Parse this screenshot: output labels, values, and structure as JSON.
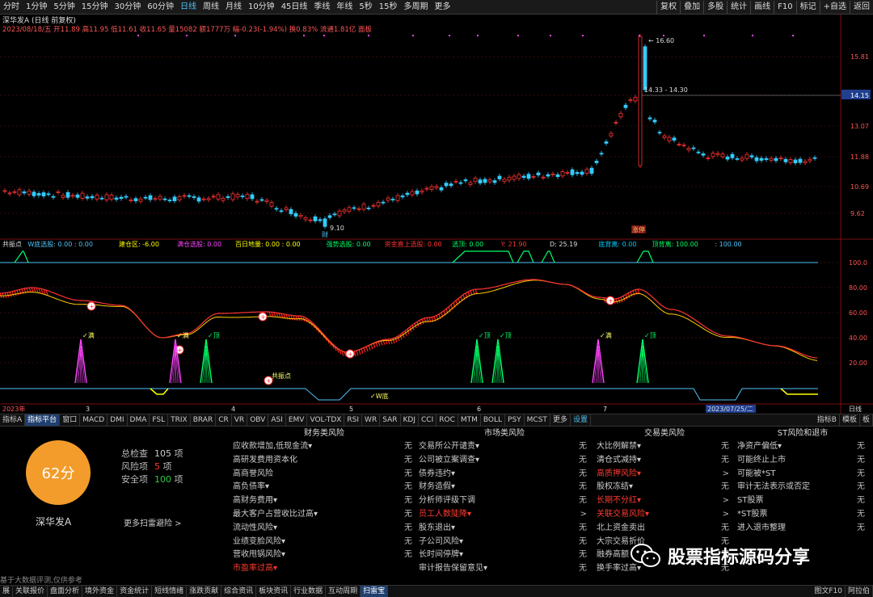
{
  "toolbar": {
    "timeframes": [
      "分时",
      "1分钟",
      "5分钟",
      "15分钟",
      "30分钟",
      "60分钟",
      "日线",
      "周线",
      "月线",
      "10分钟",
      "45日线",
      "季线",
      "年线",
      "5秒",
      "15秒",
      "多周期",
      "更多"
    ],
    "active": "日线",
    "buttons": [
      "复权",
      "叠加",
      "多股",
      "统计",
      "画线",
      "F10",
      "标记",
      "+自选",
      "返回"
    ]
  },
  "chart_header": {
    "line1": "深华发A (日线 前复权)",
    "line2": "2023/08/18/五 开11.89 高11.95 低11.61 收11.65 量15082 额1777万 幅-0.23(-1.94%) 换0.83% 流通1.81亿 面板"
  },
  "price_axis": [
    "15.81",
    "14.15",
    "13.07",
    "11.88",
    "10.69",
    "9.62"
  ],
  "current_price": "14.15",
  "price_annotations": {
    "high": "16.60",
    "range": "14.33 - 14.30",
    "low": "9.10"
  },
  "event_tags": [
    "财",
    "涨停"
  ],
  "indicator": {
    "header": [
      {
        "text": "共振点",
        "color": "#dddddd"
      },
      {
        "text": "W底选股: 0.00 : 0.00",
        "color": "#4fc3f7"
      },
      {
        "text": "建仓区: -6.00",
        "color": "#ffff00"
      },
      {
        "text": "满仓选股: 0.00",
        "color": "#ff44ff"
      },
      {
        "text": "百日地量: 0.00 : 0.00",
        "color": "#ffff00"
      },
      {
        "text": "强势选股: 0.00",
        "color": "#00ff66"
      },
      {
        "text": "资金直上选股: 0.00",
        "color": "#ff3333"
      },
      {
        "text": "选顶: 0.00",
        "color": "#00ff66"
      },
      {
        "text": "Y: 21.90",
        "color": "#ff3333"
      },
      {
        "text": "D: 25.19",
        "color": "#dddddd"
      },
      {
        "text": "底背离: 0.00",
        "color": "#00ccff"
      },
      {
        "text": "顶背离: 100.00",
        "color": "#00ff66"
      },
      {
        "text": ": 100.00",
        "color": "#4fc3f7"
      }
    ],
    "axis": [
      "100.0",
      "80.00",
      "60.00",
      "40.00",
      "20.00"
    ],
    "labels": {
      "man": "满",
      "ding": "顶",
      "gongzhen": "共振点",
      "wdi": "W底"
    }
  },
  "time_axis": [
    "2023年",
    "3",
    "4",
    "5",
    "6",
    "7",
    "2023/07/25/二",
    "日线"
  ],
  "tabs": [
    "指标A",
    "指标平台",
    "窗口",
    "MACD",
    "DMI",
    "DMA",
    "FSL",
    "TRIX",
    "BRAR",
    "CR",
    "VR",
    "OBV",
    "ASI",
    "EMV",
    "VOL-TDX",
    "RSI",
    "WR",
    "SAR",
    "KDJ",
    "CCI",
    "ROC",
    "MTM",
    "BOLL",
    "PSY",
    "MCST",
    "更多",
    "设置"
  ],
  "tabs_right": [
    "指标B",
    "模板",
    "板"
  ],
  "risk": {
    "score": "62分",
    "stock_name": "深华发A",
    "stats": [
      {
        "label": "总检查",
        "value": "105",
        "unit": "项",
        "color": "#cccccc"
      },
      {
        "label": "风险项",
        "value": "5",
        "unit": "项",
        "color": "#ff3b2f"
      },
      {
        "label": "安全项",
        "value": "100",
        "unit": "项",
        "color": "#2ecc40"
      }
    ],
    "more": "更多扫雷避险 >",
    "footnote": "基于大数据评测,仅供参考",
    "categories": [
      {
        "title": "财务类风险",
        "items": [
          {
            "label": "应收款增加,低现金流▾",
            "value": "无",
            "red": false
          },
          {
            "label": "高研发费用资本化",
            "value": "无",
            "red": false
          },
          {
            "label": "高商誉风险",
            "value": "无",
            "red": false
          },
          {
            "label": "高负债率▾",
            "value": "无",
            "red": false
          },
          {
            "label": "高财务费用▾",
            "value": "无",
            "red": false
          },
          {
            "label": "最大客户占营收比过高▾",
            "value": "无",
            "red": false
          },
          {
            "label": "流动性风险▾",
            "value": "无",
            "red": false
          },
          {
            "label": "业绩变脸风险▾",
            "value": "无",
            "red": false
          },
          {
            "label": "营收甩锅风险▾",
            "value": "无",
            "red": false
          },
          {
            "label": "市盈率过高▾",
            "value": "",
            "red": true
          }
        ]
      },
      {
        "title": "市场类风险",
        "items": [
          {
            "label": "交易所公开谴责▾",
            "value": "无",
            "red": false
          },
          {
            "label": "公司被立案调查▾",
            "value": "无",
            "red": false
          },
          {
            "label": "债券违约▾",
            "value": "无",
            "red": false
          },
          {
            "label": "财务造假▾",
            "value": "无",
            "red": false
          },
          {
            "label": "分析师评级下调",
            "value": "无",
            "red": false
          },
          {
            "label": "员工人数陡降▾",
            "value": ">",
            "red": true
          },
          {
            "label": "股东退出▾",
            "value": "无",
            "red": false
          },
          {
            "label": "子公司风险▾",
            "value": "无",
            "red": false
          },
          {
            "label": "长时间停牌▾",
            "value": "无",
            "red": false
          },
          {
            "label": "审计报告保留意见▾",
            "value": "无",
            "red": false
          }
        ]
      },
      {
        "title": "交易类风险",
        "items": [
          {
            "label": "大比例解禁▾",
            "value": "无",
            "red": false
          },
          {
            "label": "清仓式减持▾",
            "value": "无",
            "red": false
          },
          {
            "label": "高质押风险▾",
            "value": ">",
            "red": true
          },
          {
            "label": "股权冻结▾",
            "value": "无",
            "red": false
          },
          {
            "label": "长期不分红▾",
            "value": ">",
            "red": true
          },
          {
            "label": "关联交易风险▾",
            "value": ">",
            "red": true
          },
          {
            "label": "北上资金卖出",
            "value": "无",
            "red": false
          },
          {
            "label": "大宗交易折价",
            "value": "无",
            "red": false
          },
          {
            "label": "融券高额",
            "value": "无",
            "red": false
          },
          {
            "label": "换手率过高▾",
            "value": "无",
            "red": false
          }
        ]
      },
      {
        "title": "ST风险和退市",
        "items": [
          {
            "label": "净资产偏低▾",
            "value": "无",
            "red": false
          },
          {
            "label": "可能终止上市",
            "value": "无",
            "red": false
          },
          {
            "label": "可能被*ST",
            "value": "无",
            "red": false
          },
          {
            "label": "审计无法表示或否定",
            "value": "无",
            "red": false
          },
          {
            "label": "ST股票",
            "value": "无",
            "red": false
          },
          {
            "label": "*ST股票",
            "value": "无",
            "red": false
          },
          {
            "label": "进入退市整理",
            "value": "无",
            "red": false
          }
        ]
      }
    ]
  },
  "watermark": "股票指标源码分享",
  "bottom_tabs": [
    "展",
    "关联报价",
    "盘面分析",
    "境外资金",
    "资金统计",
    "短线情绪",
    "涨跌贡献",
    "综合资讯",
    "板块资讯",
    "行业数据",
    "互动周期",
    "扫雷宝"
  ],
  "bottom_active": "扫雷宝",
  "bottom_right": [
    "图文F10",
    "阿拉伯"
  ],
  "colors": {
    "up": "#ff3333",
    "down": "#33ccff",
    "bg": "#000000",
    "score": "#f39c2b"
  }
}
